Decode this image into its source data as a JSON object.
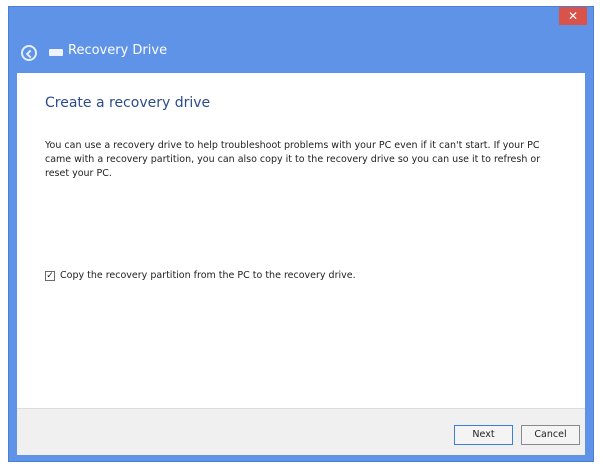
{
  "window": {
    "close_glyph": "✕",
    "title": "Recovery Drive"
  },
  "icons": {
    "back": "back-arrow-icon",
    "drive": "drive-icon",
    "checkmark": "checkmark-icon"
  },
  "colors": {
    "frame": "#5f93e8",
    "close": "#d9534a",
    "heading": "#2b4c8c",
    "footer": "#f0f0f0"
  },
  "page": {
    "heading": "Create a recovery drive",
    "description": "You can use a recovery drive to help troubleshoot problems with your PC even if it can't start. If your PC came with a recovery partition, you can also copy it to the recovery drive so you can use it to refresh or reset your PC.",
    "checkbox": {
      "checked": true,
      "check_glyph": "✓",
      "label": "Copy the recovery partition from the PC to the recovery drive."
    }
  },
  "footer": {
    "next_label": "Next",
    "cancel_label": "Cancel"
  }
}
